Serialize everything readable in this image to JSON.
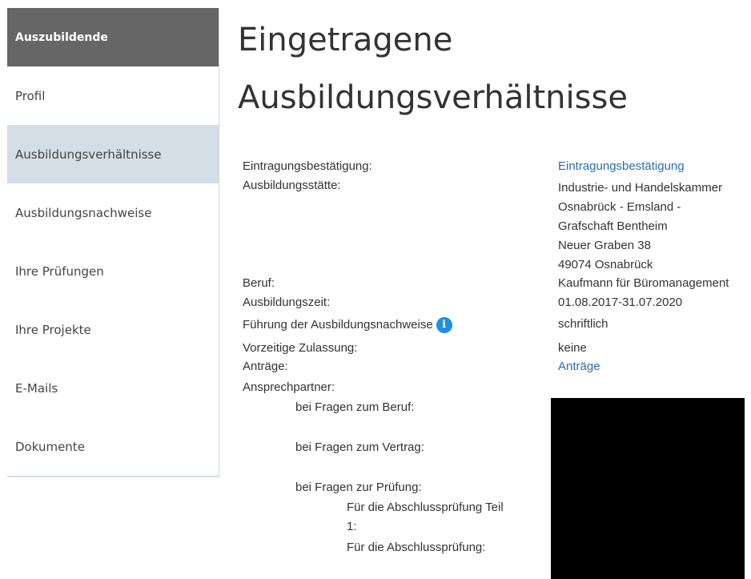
{
  "sidebar": {
    "header": "Auszubildende",
    "items": [
      {
        "label": "Profil"
      },
      {
        "label": "Ausbildungsverhältnisse"
      },
      {
        "label": "Ausbildungsnachweise"
      },
      {
        "label": "Ihre Prüfungen"
      },
      {
        "label": "Ihre Projekte"
      },
      {
        "label": "E-Mails"
      },
      {
        "label": "Dokumente"
      }
    ],
    "active_item": "Ausbildungsverhältnisse"
  },
  "main": {
    "title_line1": "Eingetragene",
    "title_line2": "Ausbildungsverhältnisse",
    "labels": {
      "eintragung": "Eintragungsbestätigung:",
      "ausbildungsstaette": "Ausbildungsstätte:",
      "beruf": "Beruf:",
      "ausbildungszeit": "Ausbildungszeit:",
      "fuehrung": "Führung der Ausbildungsnachweise",
      "zulassung": "Vorzeitige Zulassung:",
      "antraege": "Anträge:",
      "ansprechpartner": "Ansprechpartner:",
      "fragen_beruf": "bei Fragen zum Beruf:",
      "fragen_vertrag": "bei Fragen zum Vertrag:",
      "fragen_pruefung": "bei Fragen zur Prüfung:",
      "teil1_line1": "Für die Abschlussprüfung Teil",
      "teil1_line2": "1:",
      "abschluss": "Für die Abschlussprüfung:"
    },
    "values": {
      "eintragung_link": "Eintragungsbestätigung",
      "address": [
        "Industrie- und Handelskammer",
        "Osnabrück - Emsland -",
        "Grafschaft Bentheim",
        "Neuer Graben 38",
        "49074 Osnabrück"
      ],
      "beruf": "Kaufmann für Büromanagement",
      "ausbildungszeit": "01.08.2017-31.07.2020",
      "fuehrung": "schriftlich",
      "zulassung": "keine",
      "antraege_link": "Anträge"
    },
    "info_icon_glyph": "i"
  },
  "colors": {
    "sidebar_header_bg": "#666666",
    "sidebar_active_bg": "#d3dee6",
    "link": "#2a6ead",
    "info_icon": "#1e8ee6"
  }
}
